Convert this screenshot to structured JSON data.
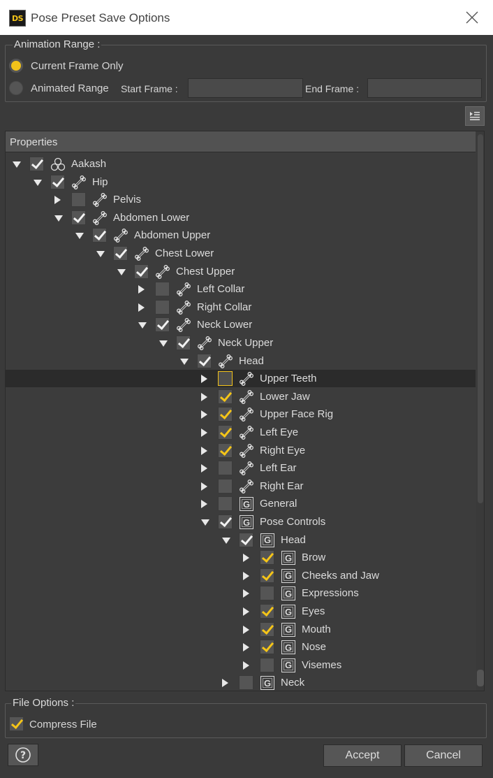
{
  "window": {
    "logo_text": "DS",
    "title": "Pose Preset Save Options"
  },
  "animation_range": {
    "title": "Animation Range :",
    "current_frame_label": "Current Frame Only",
    "current_frame_selected": true,
    "animated_range_label": "Animated Range",
    "start_frame_label": "Start Frame :",
    "start_frame_value": "",
    "end_frame_label": "End Frame :",
    "end_frame_value": ""
  },
  "properties": {
    "header": "Properties",
    "nodes": [
      {
        "label": "Aakash",
        "depth": 0,
        "expand": "down",
        "check": "white",
        "icon": "figure"
      },
      {
        "label": "Hip",
        "depth": 1,
        "expand": "down",
        "check": "white",
        "icon": "bone"
      },
      {
        "label": "Pelvis",
        "depth": 2,
        "expand": "right",
        "check": "none",
        "icon": "bone"
      },
      {
        "label": "Abdomen Lower",
        "depth": 2,
        "expand": "down",
        "check": "white",
        "icon": "bone"
      },
      {
        "label": "Abdomen Upper",
        "depth": 3,
        "expand": "down",
        "check": "white",
        "icon": "bone"
      },
      {
        "label": "Chest Lower",
        "depth": 4,
        "expand": "down",
        "check": "white",
        "icon": "bone"
      },
      {
        "label": "Chest Upper",
        "depth": 5,
        "expand": "down",
        "check": "white",
        "icon": "bone"
      },
      {
        "label": "Left Collar",
        "depth": 6,
        "expand": "right",
        "check": "none",
        "icon": "bone"
      },
      {
        "label": "Right Collar",
        "depth": 6,
        "expand": "right",
        "check": "none",
        "icon": "bone"
      },
      {
        "label": "Neck Lower",
        "depth": 6,
        "expand": "down",
        "check": "white",
        "icon": "bone"
      },
      {
        "label": "Neck Upper",
        "depth": 7,
        "expand": "down",
        "check": "white",
        "icon": "bone"
      },
      {
        "label": "Head",
        "depth": 8,
        "expand": "down",
        "check": "white",
        "icon": "bone"
      },
      {
        "label": "Upper Teeth",
        "depth": 9,
        "expand": "right",
        "check": "outlined",
        "icon": "bone",
        "selected": true
      },
      {
        "label": "Lower Jaw",
        "depth": 9,
        "expand": "right",
        "check": "yellow",
        "icon": "bone"
      },
      {
        "label": "Upper Face Rig",
        "depth": 9,
        "expand": "right",
        "check": "yellow",
        "icon": "bone"
      },
      {
        "label": "Left Eye",
        "depth": 9,
        "expand": "right",
        "check": "yellow",
        "icon": "bone"
      },
      {
        "label": "Right Eye",
        "depth": 9,
        "expand": "right",
        "check": "yellow",
        "icon": "bone"
      },
      {
        "label": "Left Ear",
        "depth": 9,
        "expand": "right",
        "check": "none",
        "icon": "bone"
      },
      {
        "label": "Right Ear",
        "depth": 9,
        "expand": "right",
        "check": "none",
        "icon": "bone"
      },
      {
        "label": "General",
        "depth": 9,
        "expand": "right",
        "check": "none",
        "icon": "group"
      },
      {
        "label": "Pose Controls",
        "depth": 9,
        "expand": "down",
        "check": "white",
        "icon": "group"
      },
      {
        "label": "Head",
        "depth": 10,
        "expand": "down",
        "check": "white",
        "icon": "group"
      },
      {
        "label": "Brow",
        "depth": 11,
        "expand": "right",
        "check": "yellow",
        "icon": "group"
      },
      {
        "label": "Cheeks and Jaw",
        "depth": 11,
        "expand": "right",
        "check": "yellow",
        "icon": "group"
      },
      {
        "label": "Expressions",
        "depth": 11,
        "expand": "right",
        "check": "none",
        "icon": "group"
      },
      {
        "label": "Eyes",
        "depth": 11,
        "expand": "right",
        "check": "yellow",
        "icon": "group"
      },
      {
        "label": "Mouth",
        "depth": 11,
        "expand": "right",
        "check": "yellow",
        "icon": "group"
      },
      {
        "label": "Nose",
        "depth": 11,
        "expand": "right",
        "check": "yellow",
        "icon": "group"
      },
      {
        "label": "Visemes",
        "depth": 11,
        "expand": "right",
        "check": "none",
        "icon": "group"
      },
      {
        "label": "Neck",
        "depth": 10,
        "expand": "right",
        "check": "none",
        "icon": "group"
      }
    ],
    "group_icon_letter": "G"
  },
  "file_options": {
    "title": "File Options :",
    "compress_label": "Compress File",
    "compress_checked": true
  },
  "buttons": {
    "help_symbol": "?",
    "accept": "Accept",
    "cancel": "Cancel"
  },
  "colors": {
    "accent_yellow": "#f5c518",
    "background": "#3a3a3a"
  }
}
